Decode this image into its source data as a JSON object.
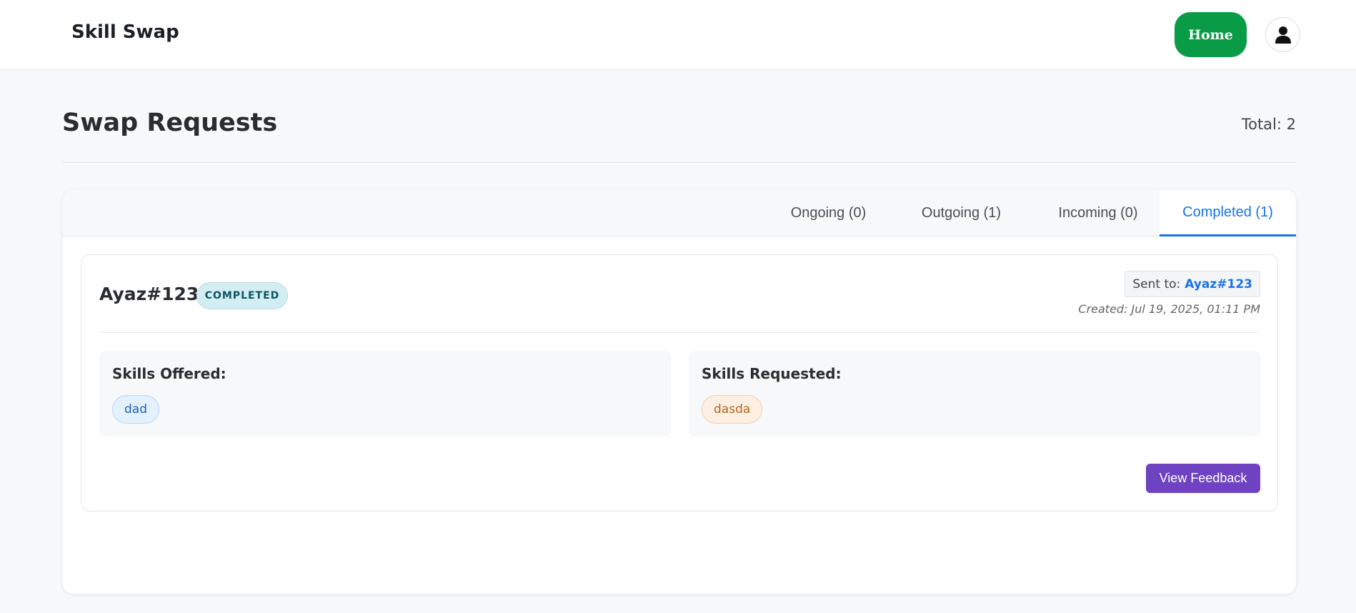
{
  "navbar": {
    "brand": "Skill Swap",
    "home_label": "Home",
    "profile_icon": "user-icon"
  },
  "header": {
    "title": "Swap Requests",
    "total": "Total: 2"
  },
  "tabs": [
    {
      "label": "Ongoing (0)",
      "active": false
    },
    {
      "label": "Outgoing (1)",
      "active": false
    },
    {
      "label": "Incoming (0)",
      "active": false
    },
    {
      "label": "Completed (1)",
      "active": true
    }
  ],
  "request": {
    "user": "Ayaz#123",
    "status": "COMPLETED",
    "sent_to_label": "Sent to:",
    "sent_to_name": "Ayaz#123",
    "created": "Created: Jul 19, 2025, 01:11 PM",
    "offered_label": "Skills Offered:",
    "offered_skills": [
      "dad"
    ],
    "requested_label": "Skills Requested:",
    "requested_skills": [
      "dasda"
    ],
    "feedback_button": "View Feedback"
  },
  "colors": {
    "home": "#0a9b47",
    "tab_active": "#1a73e8",
    "feedback": "#6f42c1",
    "badge_bg": "#d3eef3"
  }
}
